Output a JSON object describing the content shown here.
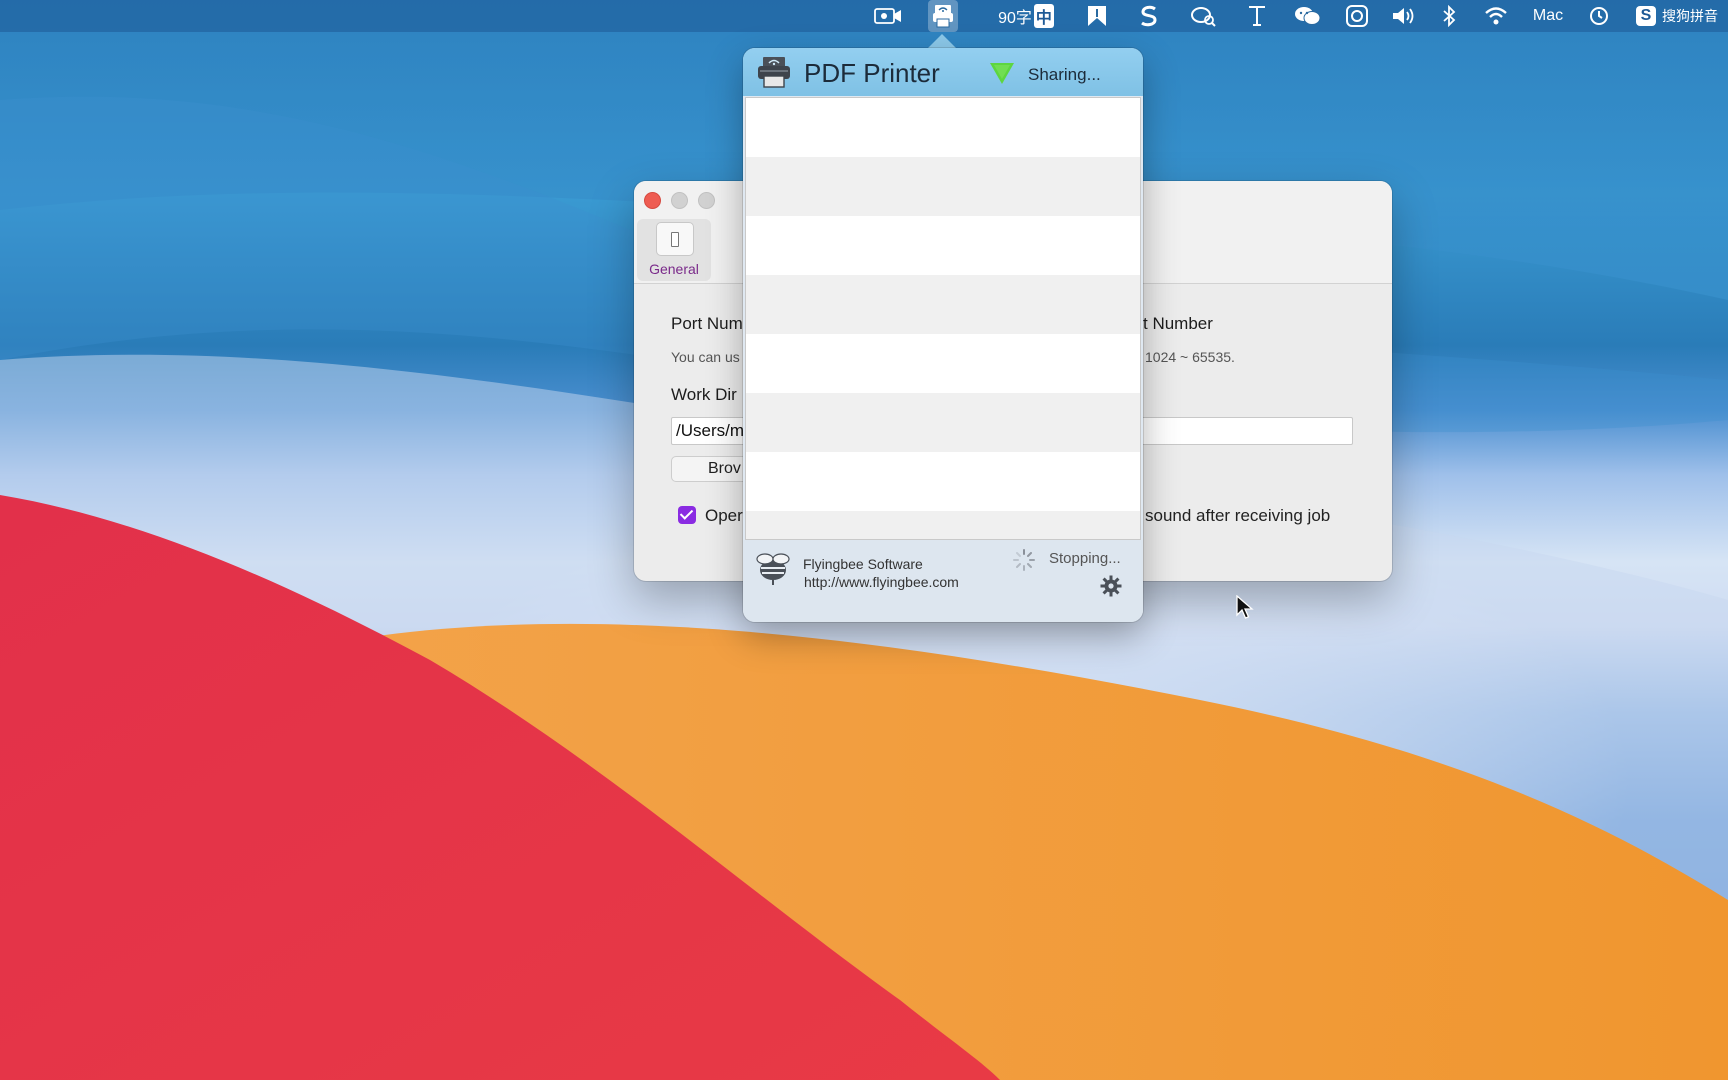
{
  "menubar": {
    "word_count": "90字",
    "input_mode": "中",
    "user": "Mac",
    "input_method": "搜狗拼音"
  },
  "prefs": {
    "tab_general": "General",
    "port_heading_left": "Port Num",
    "port_heading_right": "t Number",
    "port_hint_left": "You can us",
    "port_hint_right": "1024 ~ 65535.",
    "workdir_heading": "Work Dir",
    "workdir_value": "/Users/m",
    "browse_label": "Brov",
    "open_label": "Oper",
    "sound_label": "sound after receiving job"
  },
  "popover": {
    "title": "PDF Printer",
    "status": "Sharing...",
    "company": "Flyingbee Software",
    "website": "http://www.flyingbee.com",
    "stop_status": "Stopping...",
    "rows": [
      "",
      "",
      "",
      "",
      "",
      "",
      "",
      ""
    ]
  },
  "colors": {
    "header_blue": "#8cc9ea",
    "signal_green": "#5dd63f",
    "checkbox_purple": "#8a2be2",
    "close_red": "#ee5c52"
  }
}
